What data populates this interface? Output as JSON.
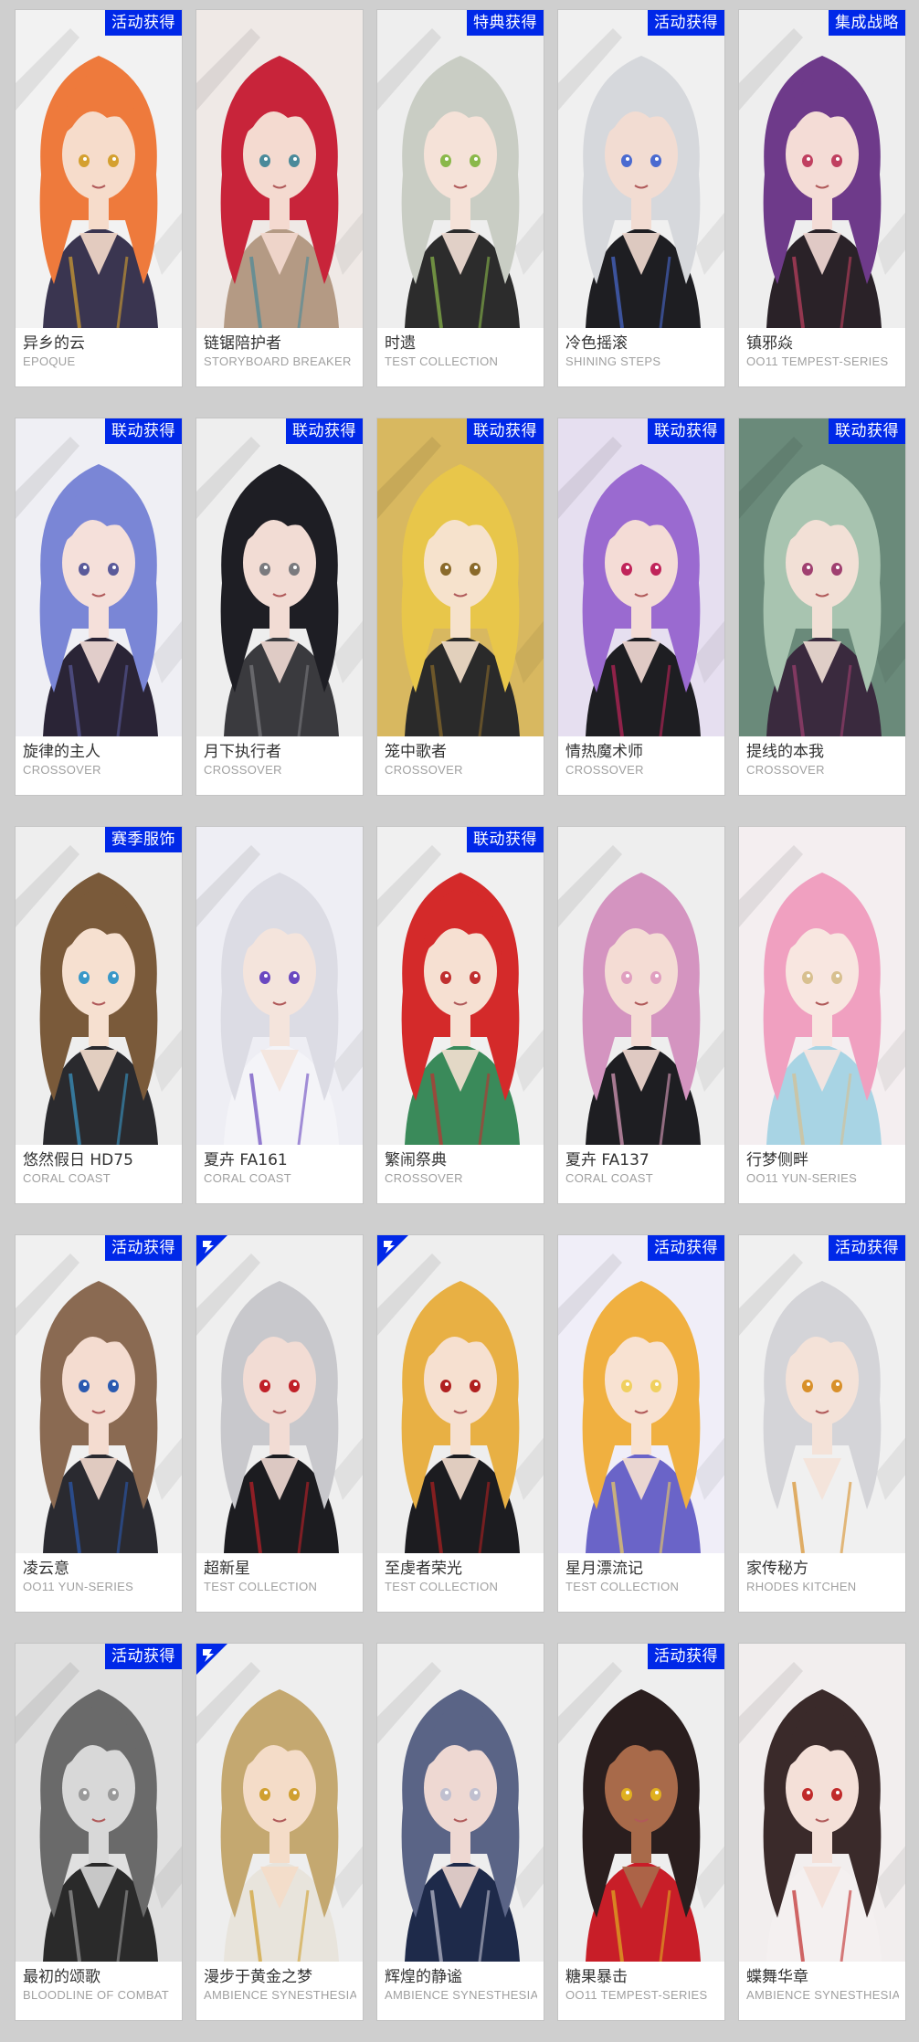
{
  "cards": [
    {
      "name": "异乡的云",
      "series": "EPOQUE",
      "badge": "活动获得",
      "hair": "#ee7a3c",
      "skin": "#f6dccb",
      "bg": "#f2f2f2",
      "outfit": "#3a3550",
      "accent": "#d4a030"
    },
    {
      "name": "链锯陪护者",
      "series": "STORYBOARD BREAKER",
      "badge": "",
      "hair": "#c8243a",
      "skin": "#f4dad0",
      "bg": "#efe9e6",
      "outfit": "#b49a84",
      "accent": "#4a8a9a"
    },
    {
      "name": "时遗",
      "series": "TEST COLLECTION",
      "badge": "特典获得",
      "hair": "#c9cdc4",
      "skin": "#f5e2d8",
      "bg": "#eeeeee",
      "outfit": "#2c2c2c",
      "accent": "#8ab84a"
    },
    {
      "name": "冷色摇滚",
      "series": "SHINING STEPS",
      "badge": "活动获得",
      "hair": "#d6d8dc",
      "skin": "#f2dcd2",
      "bg": "#f0f0f0",
      "outfit": "#1e1e22",
      "accent": "#4a6ad0"
    },
    {
      "name": "镇邪焱",
      "series": "OO11 TEMPEST-SERIES",
      "badge": "集成战略",
      "hair": "#6e3a8a",
      "skin": "#f4dcd6",
      "bg": "#eeeeee",
      "outfit": "#2a2228",
      "accent": "#c04060"
    },
    {
      "name": "旋律的主人",
      "series": "CROSSOVER",
      "badge": "联动获得",
      "hair": "#7a86d6",
      "skin": "#f5e0da",
      "bg": "#efeff4",
      "outfit": "#2a2436",
      "accent": "#5a5a9a"
    },
    {
      "name": "月下执行者",
      "series": "CROSSOVER",
      "badge": "联动获得",
      "hair": "#1e1e24",
      "skin": "#f2dcd4",
      "bg": "#eeeeee",
      "outfit": "#3a3a3e",
      "accent": "#7a7a7e"
    },
    {
      "name": "笼中歌者",
      "series": "CROSSOVER",
      "badge": "联动获得",
      "hair": "#e8c64a",
      "skin": "#f6e2cc",
      "bg": "#d8b860",
      "outfit": "#2a2a2a",
      "accent": "#8a6a2a"
    },
    {
      "name": "情热魔术师",
      "series": "CROSSOVER",
      "badge": "联动获得",
      "hair": "#9a6ad0",
      "skin": "#f4dcd6",
      "bg": "#e6dff0",
      "outfit": "#1e1e22",
      "accent": "#c0245a"
    },
    {
      "name": "提线的本我",
      "series": "CROSSOVER",
      "badge": "联动获得",
      "hair": "#a8c4b0",
      "skin": "#f2e0d6",
      "bg": "#6a8a7a",
      "outfit": "#3a2a3e",
      "accent": "#a04070"
    },
    {
      "name": "悠然假日 HD75",
      "series": "CORAL COAST",
      "badge": "赛季服饰",
      "hair": "#7a5a3a",
      "skin": "#f6e0d0",
      "bg": "#eeeeee",
      "outfit": "#2a2a2e",
      "accent": "#3a98c8"
    },
    {
      "name": "夏卉 FA161",
      "series": "CORAL COAST",
      "badge": "",
      "hair": "#dcdce4",
      "skin": "#f4e4dc",
      "bg": "#eeeef4",
      "outfit": "#f4f4f8",
      "accent": "#6a48c0"
    },
    {
      "name": "繁闹祭典",
      "series": "CROSSOVER",
      "badge": "联动获得",
      "hair": "#d42a2a",
      "skin": "#f6e0d2",
      "bg": "#f0f0f0",
      "outfit": "#3a8a5a",
      "accent": "#c03030"
    },
    {
      "name": "夏卉 FA137",
      "series": "CORAL COAST",
      "badge": "",
      "hair": "#d494c0",
      "skin": "#f4dcd4",
      "bg": "#eeeeee",
      "outfit": "#1e1e22",
      "accent": "#e0a0c0"
    },
    {
      "name": "行梦侧畔",
      "series": "OO11 YUN-SERIES",
      "badge": "",
      "hair": "#f0a0c0",
      "skin": "#f8e6e0",
      "bg": "#f4eef0",
      "outfit": "#a8d4e4",
      "accent": "#d8c090"
    },
    {
      "name": "凌云意",
      "series": "OO11 YUN-SERIES",
      "badge": "活动获得",
      "hair": "#8a6a52",
      "skin": "#f4dcd0",
      "bg": "#f0f0f0",
      "outfit": "#2a2a30",
      "accent": "#2a5ab0"
    },
    {
      "name": "超新星",
      "series": "TEST COLLECTION",
      "badge": "",
      "corner": true,
      "hair": "#c8c8cc",
      "skin": "#f2dcd4",
      "bg": "#efefef",
      "outfit": "#1c1c20",
      "accent": "#c02028"
    },
    {
      "name": "至虔者荣光",
      "series": "TEST COLLECTION",
      "badge": "",
      "corner": true,
      "hair": "#e8b044",
      "skin": "#f6e0d0",
      "bg": "#eeeeee",
      "outfit": "#1c1c20",
      "accent": "#b02020"
    },
    {
      "name": "星月漂流记",
      "series": "TEST COLLECTION",
      "badge": "活动获得",
      "hair": "#f0b040",
      "skin": "#f8e2d2",
      "bg": "#f0eef8",
      "outfit": "#6a64c8",
      "accent": "#f0d060"
    },
    {
      "name": "家传秘方",
      "series": "RHODES KITCHEN",
      "badge": "活动获得",
      "hair": "#d4d4d8",
      "skin": "#f4e2d8",
      "bg": "#f0f0f0",
      "outfit": "#f0f0f0",
      "accent": "#d8902a"
    },
    {
      "name": "最初的颂歌",
      "series": "BLOODLINE OF COMBAT",
      "badge": "活动获得",
      "hair": "#6a6a6a",
      "skin": "#d8d8d8",
      "bg": "#e0e0e0",
      "outfit": "#2a2a2a",
      "accent": "#9a9a9a"
    },
    {
      "name": "漫步于黄金之梦",
      "series": "AMBIENCE SYNESTHESIA",
      "badge": "",
      "corner": true,
      "hair": "#c4a870",
      "skin": "#f4dcc8",
      "bg": "#eeeeee",
      "outfit": "#e8e4dc",
      "accent": "#d0a030"
    },
    {
      "name": "辉煌的静谧",
      "series": "AMBIENCE SYNESTHESIA",
      "badge": "",
      "hair": "#5a6486",
      "skin": "#eed8d2",
      "bg": "#eeeeee",
      "outfit": "#1e2a4a",
      "accent": "#c0c0d0"
    },
    {
      "name": "糖果暴击",
      "series": "OO11 TEMPEST-SERIES",
      "badge": "活动获得",
      "hair": "#2a1e1e",
      "skin": "#a86a4a",
      "bg": "#eeeeee",
      "outfit": "#c81e28",
      "accent": "#e0b020"
    },
    {
      "name": "蝶舞华章",
      "series": "AMBIENCE SYNESTHESIA",
      "badge": "",
      "hair": "#3a2a2a",
      "skin": "#f4e0d8",
      "bg": "#f2eeee",
      "outfit": "#f4f0f0",
      "accent": "#c02a2a"
    }
  ]
}
